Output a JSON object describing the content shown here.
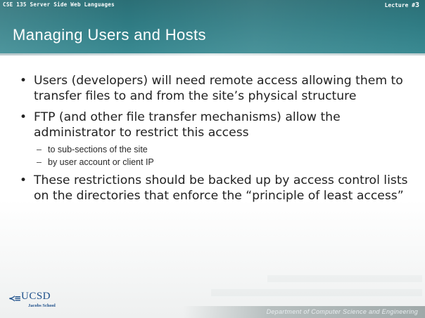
{
  "header": {
    "course": "CSE 135  Server Side Web Languages",
    "lecture_prefix": "Lecture #",
    "lecture_number": "3",
    "title": "Managing Users and Hosts"
  },
  "bullets": [
    {
      "text": "Users (developers) will need remote access allowing them to transfer files to and from the site’s physical structure",
      "subs": []
    },
    {
      "text": "FTP (and other file transfer mechanisms) allow the administrator to restrict this access",
      "subs": [
        "to sub-sections of the site",
        "by user account or client IP"
      ]
    },
    {
      "text": "These restrictions should be backed up by access control lists on the directories that enforce the “principle of least access”",
      "subs": []
    }
  ],
  "footer": {
    "logo_text": "UCSD",
    "logo_subtext": "Jacobs School",
    "department": "Department of Computer Science and Engineering"
  },
  "colors": {
    "header": "#2f7b83",
    "text": "#222222",
    "logo": "#1d4f8a"
  }
}
